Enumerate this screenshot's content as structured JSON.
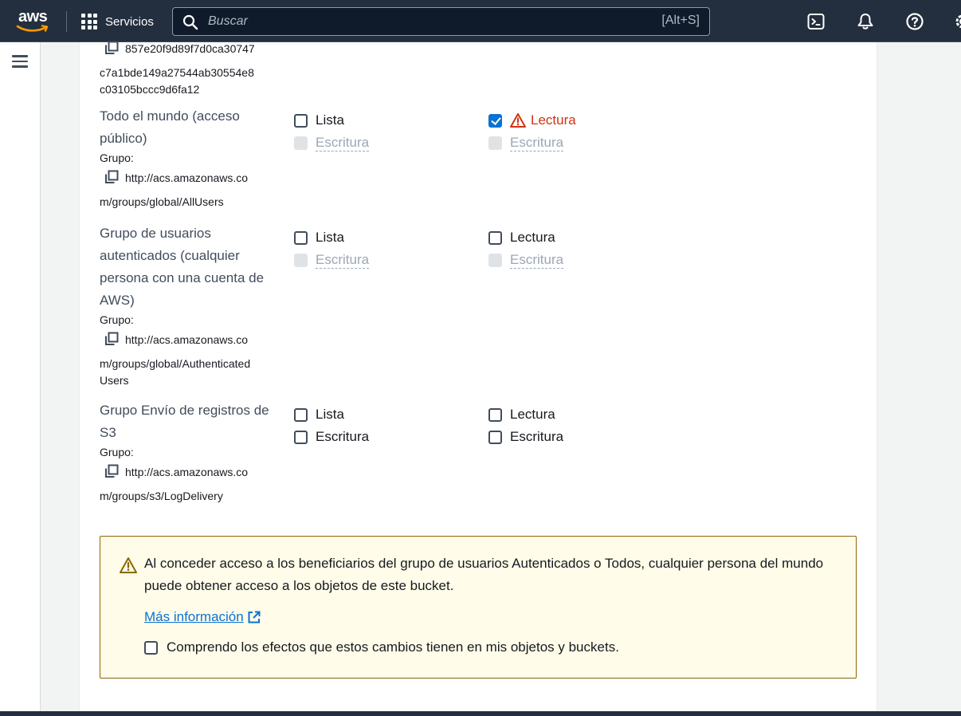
{
  "topbar": {
    "logo_text": "aws",
    "services_label": "Servicios",
    "search_placeholder": "Buscar",
    "search_shortcut": "[Alt+S]"
  },
  "grantees": [
    {
      "id_lines": [
        "857e20f9d89f7d0ca30747",
        "c7a1bde149a27544ab30554e8",
        "c03105bccc9d6fa12"
      ]
    },
    {
      "name_lines": [
        "Todo el mundo (acceso",
        "público)"
      ],
      "group_label": "Grupo:",
      "url_lines": [
        "http://acs.amazonaws.co",
        "m/groups/global/AllUsers"
      ],
      "objects": {
        "list": "Lista",
        "list_checked": false,
        "write": "Escritura",
        "write_disabled": true
      },
      "acl": {
        "read": "Lectura",
        "read_checked": true,
        "read_warning": true,
        "write": "Escritura",
        "write_disabled": true
      }
    },
    {
      "name_lines": [
        "Grupo de usuarios",
        "autenticados (cualquier",
        "persona con una cuenta de",
        "AWS)"
      ],
      "group_label": "Grupo:",
      "url_lines": [
        "http://acs.amazonaws.co",
        "m/groups/global/Authenticated",
        "Users"
      ],
      "objects": {
        "list": "Lista",
        "list_checked": false,
        "write": "Escritura",
        "write_disabled": true
      },
      "acl": {
        "read": "Lectura",
        "read_checked": false,
        "write": "Escritura",
        "write_disabled": true
      }
    },
    {
      "name_lines": [
        "Grupo Envío de registros de",
        "S3"
      ],
      "group_label": "Grupo:",
      "url_lines": [
        "http://acs.amazonaws.co",
        "m/groups/s3/LogDelivery"
      ],
      "objects": {
        "list": "Lista",
        "list_checked": false,
        "write": "Escritura",
        "write_disabled": false
      },
      "acl": {
        "read": "Lectura",
        "read_checked": false,
        "write": "Escritura",
        "write_disabled": false
      }
    }
  ],
  "alert": {
    "text": "Al conceder acceso a los beneficiarios del grupo de usuarios Autenticados o Todos, cualquier persona del mundo puede obtener acceso a los objetos de este bucket.",
    "link_label": "Más información",
    "ack_label": "Comprendo los efectos que estos cambios tienen en mis objetos y buckets.",
    "ack_checked": false
  },
  "colors": {
    "nav_bg": "#232f3e",
    "link": "#0972d3",
    "warning": "#d13212",
    "alert_bg": "#fffce9",
    "alert_border": "#8d6605"
  },
  "icons": [
    "grid-icon",
    "search-icon",
    "cloudshell-icon",
    "bell-icon",
    "help-icon",
    "gear-icon",
    "hamburger-icon",
    "copy-icon",
    "warning-icon",
    "external-link-icon"
  ]
}
